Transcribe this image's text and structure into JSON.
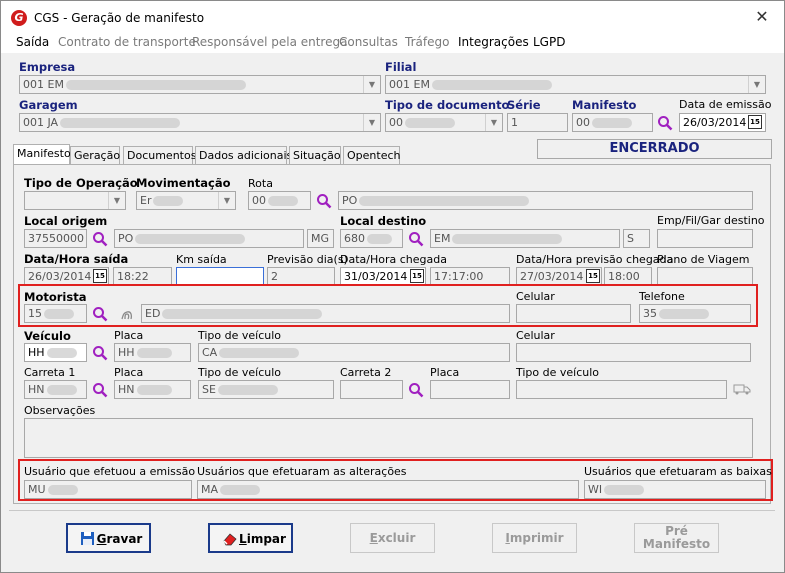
{
  "window": {
    "title": "CGS - Geração de manifesto",
    "close_glyph": "✕"
  },
  "menu": [
    "Saída",
    "Contrato de transporte",
    "Responsável pela entrega",
    "Consultas",
    "Tráfego",
    "Integrações",
    "LGPD"
  ],
  "header": {
    "empresa_label": "Empresa",
    "empresa_value": "001 EM",
    "filial_label": "Filial",
    "filial_value": "001 EM",
    "garagem_label": "Garagem",
    "garagem_value": "001 JA",
    "tipo_doc_label": "Tipo de documento",
    "tipo_doc_value": "00",
    "serie_label": "Série",
    "serie_value": "1",
    "manifesto_label": "Manifesto",
    "manifesto_value": "00",
    "data_emissao_label": "Data de emissão",
    "data_emissao_value": "26/03/2014"
  },
  "tabs": [
    "Manifesto",
    "Geração",
    "Documentos",
    "Dados adicionais",
    "Situação",
    "Opentech"
  ],
  "status": "ENCERRADO",
  "form": {
    "tipo_operacao_label": "Tipo de Operação",
    "movimentacao_label": "Movimentação",
    "movimentacao_value": "Er",
    "rota_label": "Rota",
    "rota_value": "00",
    "rota_desc": "PO",
    "local_origem_label": "Local origem",
    "local_origem_code": "37550000",
    "local_origem_name": "PO",
    "local_origem_uf": "MG",
    "local_destino_label": "Local destino",
    "local_destino_code": "680",
    "local_destino_name": "EM",
    "local_destino_uf": "S",
    "emp_fil_gar_label": "Emp/Fil/Gar destino",
    "data_saida_label": "Data/Hora saída",
    "data_saida_date": "26/03/2014",
    "data_saida_time": "18:22",
    "km_saida_label": "Km saída",
    "previsao_dias_label": "Previsão dia(s)",
    "previsao_dias_value": "2",
    "data_chegada_label": "Data/Hora chegada",
    "data_chegada_date": "31/03/2014",
    "data_chegada_time": "17:17:00",
    "previsao_chegada_label": "Data/Hora previsão chegada",
    "previsao_chegada_date": "27/03/2014",
    "previsao_chegada_time": "18:00",
    "plano_viagem_label": "Plano de Viagem",
    "motorista_label": "Motorista",
    "motorista_code": "15",
    "motorista_name": "ED",
    "celular_label": "Celular",
    "telefone_label": "Telefone",
    "telefone_value": "35",
    "veiculo_label": "Veículo",
    "veiculo_code": "HH",
    "placa_label": "Placa",
    "placa_value": "HH",
    "tipo_veiculo_label": "Tipo de veículo",
    "tipo_veiculo_value": "CA",
    "carreta1_label": "Carreta 1",
    "carreta1_code": "HN",
    "placa2_label": "Placa",
    "placa2_value": "HN",
    "tipo_veiculo2_label": "Tipo de veículo",
    "tipo_veiculo2_value": "SE",
    "carreta2_label": "Carreta 2",
    "placa3_label": "Placa",
    "tipo_veiculo3_label": "Tipo de veículo",
    "observacoes_label": "Observações",
    "usuario_emissao_label": "Usuário que efetuou a emissão",
    "usuario_emissao_value": "MU",
    "usuarios_alteracoes_label": "Usuários que efetuaram as alterações",
    "usuarios_alteracoes_value": "MA",
    "usuarios_baixas_label": "Usuários que efetuaram as baixas",
    "usuarios_baixas_value": "WI"
  },
  "buttons": {
    "gravar_u": "G",
    "gravar_rest": "ravar",
    "limpar_u": "L",
    "limpar_rest": "impar",
    "excluir_u": "E",
    "excluir_rest": "xcluir",
    "imprimir_u": "I",
    "imprimir_rest": "mprimir",
    "pre_manifesto_line1": "Pré",
    "pre_manifesto_line2": "Manifesto"
  },
  "colors": {
    "accent_blue": "#1a237e",
    "highlight_red": "#e0201f",
    "logo_red": "#d01c1c"
  },
  "icons": {
    "search": "magnifier-icon",
    "calendar": "calendar-icon",
    "gravar": "floppy-disk-icon",
    "limpar": "eraser-icon"
  }
}
